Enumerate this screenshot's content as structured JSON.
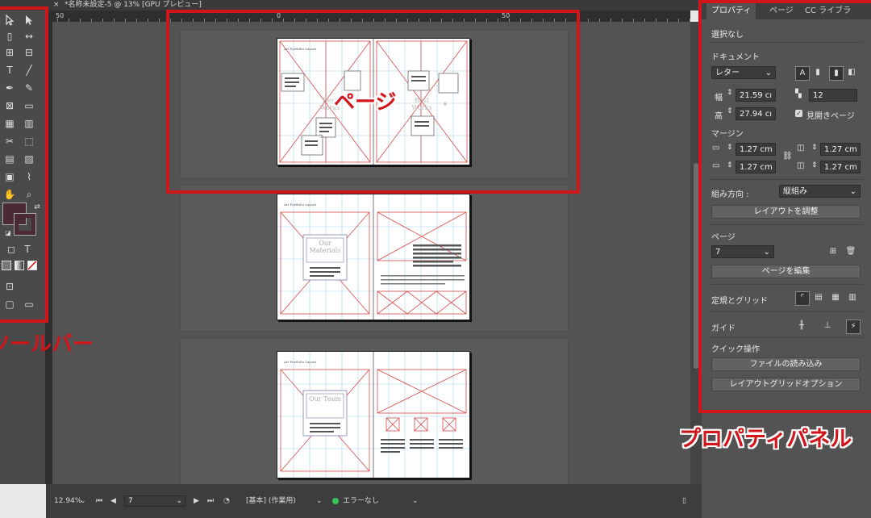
{
  "titlebar": {
    "close": "×",
    "doc_title": "*名称未設定-5 @ 13% [GPU プレビュー]"
  },
  "ruler": {
    "left": "50",
    "center": "0",
    "right": "50"
  },
  "status": {
    "zoom": "12.94%",
    "page": "7",
    "workspace": "[基本] (作業用)",
    "preflight": "エラーなし"
  },
  "panel": {
    "tabs": [
      {
        "label": "プロパティ"
      },
      {
        "label": "ページ"
      },
      {
        "label": "CC ライブラ"
      }
    ],
    "selection": "選択なし",
    "document": {
      "heading": "ドキュメント",
      "size": "レター",
      "width_label": "幅",
      "width": "21.59 cı",
      "height_label": "高",
      "height": "27.94 cı",
      "pages": "12",
      "facing_pages": "見開きページ"
    },
    "margin": {
      "heading": "マージン",
      "top": "1.27 cm",
      "bottom": "1.27 cm",
      "inside": "1.27 cm",
      "outside": "1.27 cm"
    },
    "direction_label": "組み方向 :",
    "direction_value": "縦組み",
    "adjust_layout": "レイアウトを調整",
    "page_heading": "ページ",
    "page_value": "7",
    "edit_page": "ページを編集",
    "rulers_grids": "定規とグリッド",
    "guides": "ガイド",
    "quick_actions": "クイック操作",
    "import_file": "ファイルの読み込み",
    "layout_grid_options": "レイアウトグリッドオプション"
  },
  "page_text": {
    "header": "Art Portfolio Layout",
    "best_works": "Best Works",
    "our_materials": "Our Materials",
    "our_team": "Our Team",
    "page_left": "5",
    "page_right": "6"
  },
  "annotations": {
    "page_label": "ページ",
    "toolbar_label": "ツールバー",
    "panel_label": "プロパティパネル"
  },
  "colors": {
    "accent": "#d2141b",
    "fill_swatch": "#4a2a33"
  }
}
